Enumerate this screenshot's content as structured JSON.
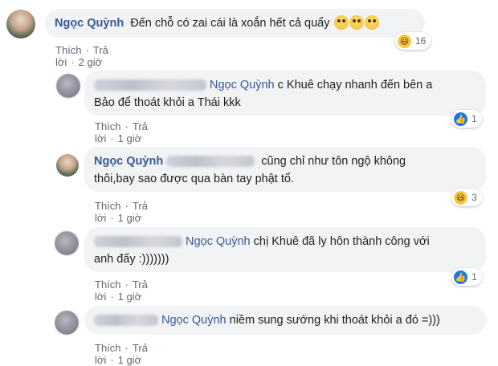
{
  "comments": [
    {
      "author": "Ngọc Quỳnh",
      "text": "Đến chỗ có zai cái là xoắn hết cả quẩy",
      "emojis": [
        "astonished-face",
        "astonished-face",
        "astonished-face"
      ],
      "reaction": {
        "icon": "haha-icon",
        "count": "16"
      },
      "actions": {
        "like": "Thích",
        "reply": "Trả lời",
        "time": "2 giờ"
      }
    },
    {
      "mention": "Ngọc Quỳnh",
      "text_line1": " c Khuê chạy nhanh đến bên a",
      "text_line2": "Bảo để thoát khỏi a Thái kkk",
      "reaction": {
        "icon": "like-icon",
        "count": "1"
      },
      "actions": {
        "like": "Thích",
        "reply": "Trả lời",
        "time": "1 giờ"
      }
    },
    {
      "author": "Ngọc Quỳnh",
      "text_line1": " cũng chỉ như tôn ngộ không",
      "text_line2": "thôi,bay sao được qua bàn tay phật tổ.",
      "reaction": {
        "icon": "haha-icon",
        "count": "3"
      },
      "actions": {
        "like": "Thích",
        "reply": "Trả lời",
        "time": "1 giờ"
      }
    },
    {
      "mention": "Ngọc Quỳnh",
      "text_line1": " chị Khuê đã ly hôn thành công với",
      "text_line2": "anh đấy :)))))))",
      "reaction": {
        "icon": "like-icon",
        "count": "1"
      },
      "actions": {
        "like": "Thích",
        "reply": "Trả lời",
        "time": "1 giờ"
      }
    },
    {
      "mention": "Ngọc Quỳnh",
      "text": " niềm sung sướng khi thoát khỏi a đó =)))",
      "actions": {
        "like": "Thích",
        "reply": "Trả lời",
        "time": "1 giờ"
      }
    }
  ]
}
